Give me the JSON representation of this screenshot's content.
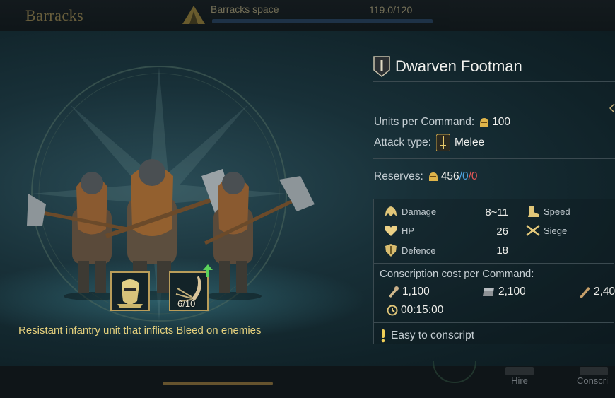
{
  "top_bar": {
    "title": "Barracks",
    "space_label": "Barracks space",
    "space_value": "119.0/120"
  },
  "unit": {
    "name": "Dwarven Footman",
    "units_per_command_label": "Units per Command:",
    "units_per_command_value": "100",
    "attack_type_label": "Attack type:",
    "attack_type_value": "Melee",
    "reserves_label": "Reserves:",
    "reserves_main": "456",
    "reserves_blue": "/0",
    "reserves_red": "/0",
    "description": "Resistant infantry unit that inflicts Bleed on enemies"
  },
  "skills": [
    {
      "icon": "dwarf-helm-portrait-icon"
    },
    {
      "icon": "bleed-claw-icon",
      "count": "6/10",
      "upgrade": "up-arrow-icon"
    }
  ],
  "stats": [
    {
      "icon": "damage-icon",
      "label": "Damage",
      "value": "8~11"
    },
    {
      "icon": "heart-icon",
      "label": "HP",
      "value": "26"
    },
    {
      "icon": "defence-shield-icon",
      "label": "Defence",
      "value": "18"
    },
    {
      "icon": "speed-boot-icon",
      "label": "Speed"
    },
    {
      "icon": "siege-icon",
      "label": "Siege"
    }
  ],
  "conscription": {
    "title": "Conscription cost per Command:",
    "food": "1,100",
    "iron": "2,100",
    "wood": "2,40",
    "time": "00:15:00",
    "note": "Easy to conscript"
  },
  "bottom": {
    "hire_label": "Hire",
    "conscript_label": "Conscri"
  },
  "colors": {
    "gold": "#e4cf7c",
    "accent_blue": "#4fa3e0",
    "accent_red": "#e05656",
    "panel_bg": "#183038"
  }
}
